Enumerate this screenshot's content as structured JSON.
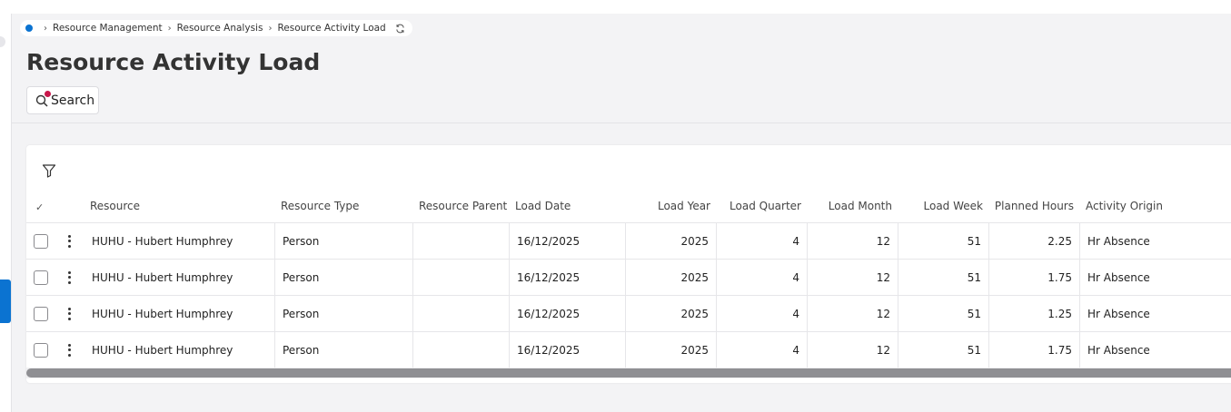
{
  "breadcrumb": {
    "items": [
      "Resource Management",
      "Resource Analysis",
      "Resource Activity Load"
    ]
  },
  "page": {
    "title": "Resource Activity Load",
    "search_label": "Search"
  },
  "table": {
    "check_symbol": "✓",
    "columns": {
      "resource": "Resource",
      "resource_type": "Resource Type",
      "resource_parent": "Resource Parent",
      "load_date": "Load Date",
      "load_year": "Load Year",
      "load_quarter": "Load Quarter",
      "load_month": "Load Month",
      "load_week": "Load Week",
      "planned_hours": "Planned Hours",
      "activity_origin": "Activity Origin"
    },
    "rows": [
      {
        "resource": "HUHU - Hubert  Humphrey",
        "resource_type": "Person",
        "resource_parent": "",
        "load_date": "16/12/2025",
        "load_year": "2025",
        "load_quarter": "4",
        "load_month": "12",
        "load_week": "51",
        "planned_hours": "2.25",
        "activity_origin": "Hr Absence"
      },
      {
        "resource": "HUHU - Hubert  Humphrey",
        "resource_type": "Person",
        "resource_parent": "",
        "load_date": "16/12/2025",
        "load_year": "2025",
        "load_quarter": "4",
        "load_month": "12",
        "load_week": "51",
        "planned_hours": "1.75",
        "activity_origin": "Hr Absence"
      },
      {
        "resource": "HUHU - Hubert  Humphrey",
        "resource_type": "Person",
        "resource_parent": "",
        "load_date": "16/12/2025",
        "load_year": "2025",
        "load_quarter": "4",
        "load_month": "12",
        "load_week": "51",
        "planned_hours": "1.25",
        "activity_origin": "Hr Absence"
      },
      {
        "resource": "HUHU - Hubert  Humphrey",
        "resource_type": "Person",
        "resource_parent": "",
        "load_date": "16/12/2025",
        "load_year": "2025",
        "load_quarter": "4",
        "load_month": "12",
        "load_week": "51",
        "planned_hours": "1.75",
        "activity_origin": "Hr Absence"
      }
    ]
  },
  "colors": {
    "accent": "#0b73d1",
    "notification_dot": "#c8174a"
  },
  "icons": [
    "home-dot-icon",
    "chevron-right-icon",
    "refresh-icon",
    "search-icon",
    "filter-icon",
    "kebab-menu-icon",
    "checkbox-icon"
  ]
}
